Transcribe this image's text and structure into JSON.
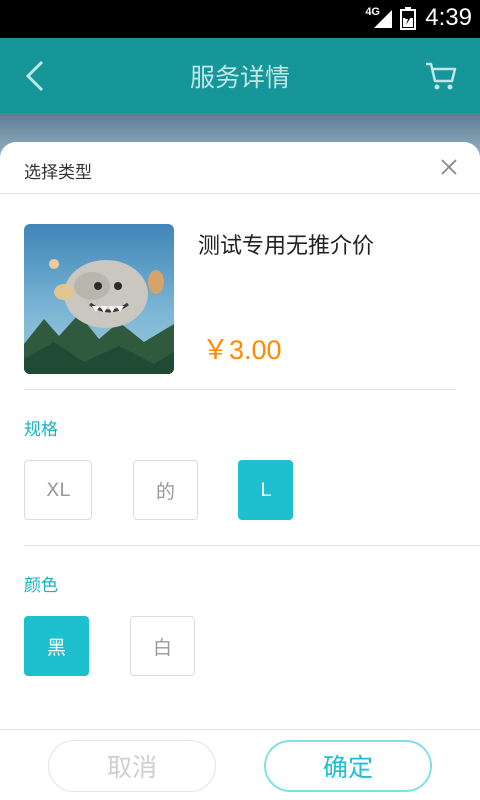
{
  "status_bar": {
    "network": "4G",
    "time": "4:39"
  },
  "header": {
    "title": "服务详情"
  },
  "sheet": {
    "title": "选择类型",
    "product": {
      "name": "测试专用无推介价",
      "price": "￥3.00"
    },
    "spec": {
      "label": "规格",
      "options": [
        "XL",
        "的",
        "L"
      ],
      "selected": "L"
    },
    "color": {
      "label": "颜色",
      "options": [
        "黑",
        "白"
      ],
      "selected": "黑"
    }
  },
  "footer": {
    "cancel_label": "取消",
    "confirm_label": "确定"
  },
  "colors": {
    "accent": "#1ec0cf",
    "header": "#17969a",
    "price": "#ff8a00"
  }
}
